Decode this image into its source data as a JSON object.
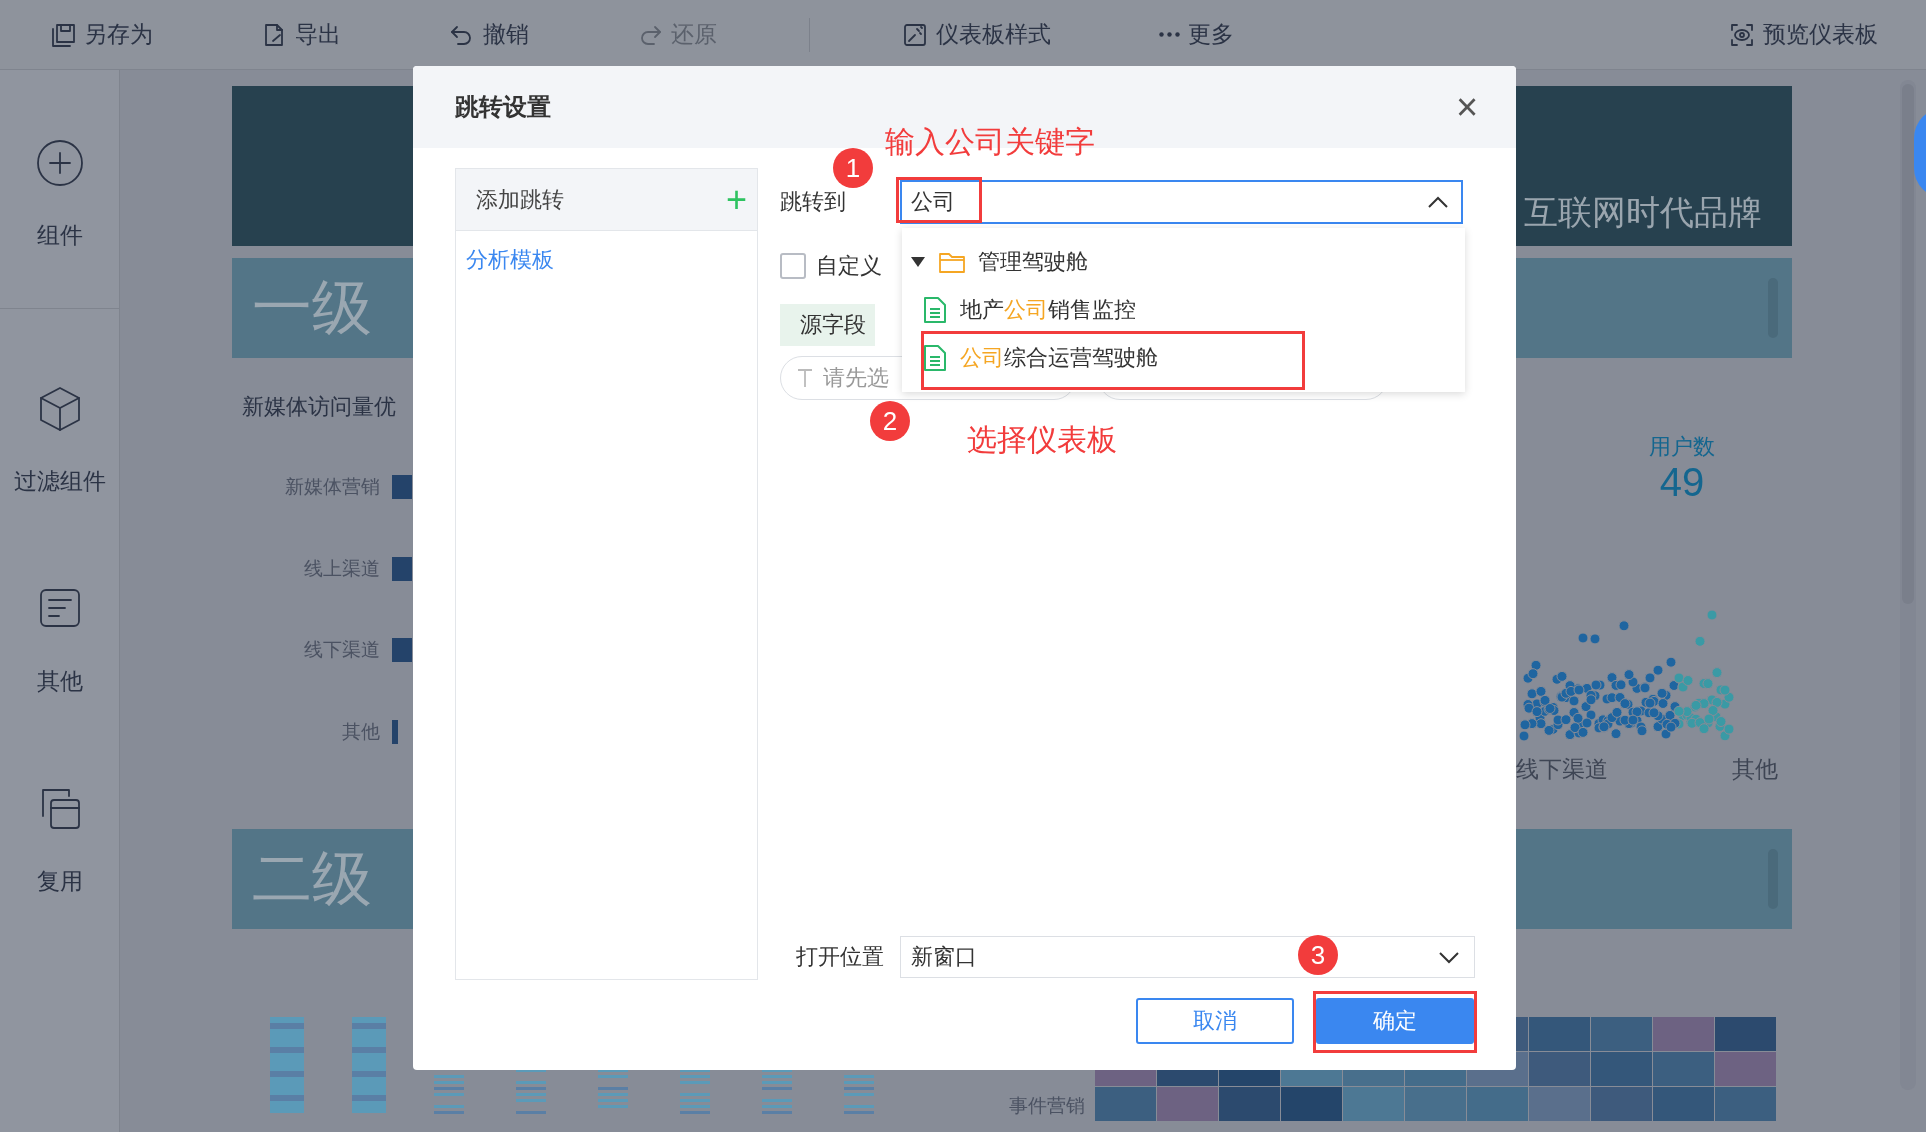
{
  "toolbar": {
    "items": [
      {
        "kind": "save",
        "label": "另存为",
        "disabled": false
      },
      {
        "kind": "export",
        "label": "导出",
        "disabled": false
      },
      {
        "kind": "undo",
        "label": "撤销",
        "disabled": false
      },
      {
        "kind": "redo",
        "label": "还原",
        "disabled": true
      },
      {
        "kind": "style",
        "label": "仪表板样式",
        "disabled": false
      },
      {
        "kind": "more",
        "label": "更多",
        "disabled": false
      }
    ],
    "preview": {
      "label": "预览仪表板"
    }
  },
  "sidebar": {
    "items": [
      {
        "kind": "add",
        "label": "组件"
      },
      {
        "kind": "cube",
        "label": "过滤组件"
      },
      {
        "kind": "note",
        "label": "其他"
      },
      {
        "kind": "copy",
        "label": "复用"
      }
    ]
  },
  "dashboard": {
    "banner_title": "互联网时代品牌",
    "section_1": "一级",
    "bar_chart": {
      "title": "新媒体访问量优",
      "rows": [
        {
          "label": "新媒体营销"
        },
        {
          "label": "线上渠道"
        },
        {
          "label": "线下渠道"
        },
        {
          "label": "其他"
        }
      ]
    },
    "kpi": {
      "label": "用户数",
      "value": "49"
    },
    "scatter_labels": [
      "线下渠道",
      "其他"
    ],
    "section_2": "二级",
    "heatmap_row_label": "事件营销"
  },
  "dialog": {
    "title": "跳转设置",
    "close": "×",
    "list": {
      "header": "添加跳转",
      "add": "+",
      "items": [
        {
          "label": "分析模板",
          "selected": true
        }
      ]
    },
    "target": {
      "label": "跳转到",
      "value": "公司",
      "expanded": true,
      "options": [
        {
          "kind": "folder",
          "segments": [
            {
              "text": "管理驾驶舱",
              "highlight": false
            }
          ],
          "expanded": true,
          "children": [
            {
              "kind": "file",
              "segments": [
                {
                  "text": "地产",
                  "highlight": false
                },
                {
                  "text": "公司",
                  "highlight": true
                },
                {
                  "text": "销售监控",
                  "highlight": false
                }
              ]
            },
            {
              "kind": "file",
              "segments": [
                {
                  "text": "公司",
                  "highlight": true
                },
                {
                  "text": "综合运营驾驶舱",
                  "highlight": false
                }
              ]
            }
          ]
        }
      ]
    },
    "custom": {
      "label": "自定义",
      "checked": false
    },
    "source_field": {
      "header": "源字段",
      "placeholder": "请先选"
    },
    "open_position": {
      "label": "打开位置",
      "value": "新窗口"
    },
    "buttons": [
      {
        "kind": "secondary",
        "label": "取消"
      },
      {
        "kind": "primary",
        "label": "确定"
      }
    ]
  },
  "annotations": [
    {
      "kind": "note",
      "text": "输入公司关键字"
    },
    {
      "kind": "step",
      "text": "1"
    },
    {
      "kind": "frame"
    },
    {
      "kind": "frame"
    },
    {
      "kind": "step",
      "text": "2"
    },
    {
      "kind": "note",
      "text": "选择仪表板"
    },
    {
      "kind": "step",
      "text": "3"
    },
    {
      "kind": "frame"
    }
  ]
}
